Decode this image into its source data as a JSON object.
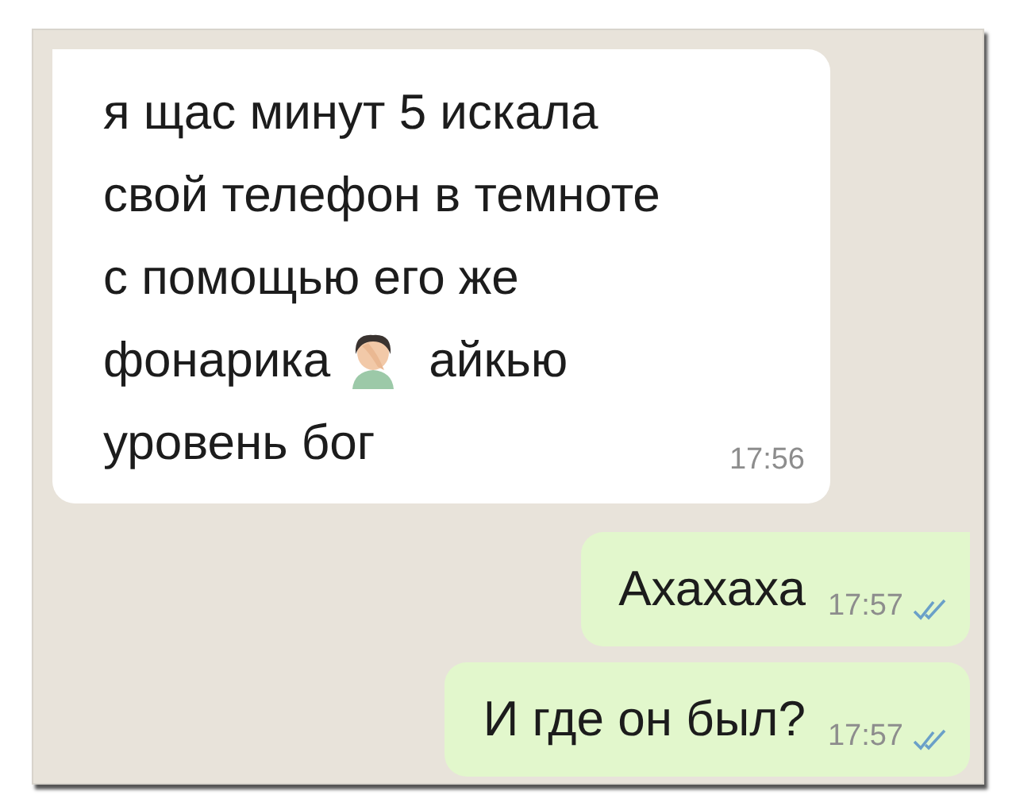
{
  "messages": [
    {
      "kind": "incoming",
      "lines": [
        [
          {
            "kind": "text",
            "text": "я щас минут 5 искала"
          }
        ],
        [
          {
            "kind": "text",
            "text": "свой телефон в темноте"
          }
        ],
        [
          {
            "kind": "text",
            "text": "с помощью его же"
          }
        ],
        [
          {
            "kind": "text",
            "text": "фонарика"
          },
          {
            "kind": "emoji"
          },
          {
            "kind": "text",
            "text": "айкью"
          }
        ],
        [
          {
            "kind": "text",
            "text": "уровень бог"
          }
        ]
      ],
      "time": "17:56"
    },
    {
      "kind": "outgoing",
      "lines": [
        [
          {
            "kind": "text",
            "text": "Ахахаха"
          }
        ]
      ],
      "time": "17:57",
      "read": true
    },
    {
      "kind": "outgoing",
      "lines": [
        [
          {
            "kind": "text",
            "text": "И где он был?"
          }
        ]
      ],
      "time": "17:57",
      "read": true
    }
  ]
}
